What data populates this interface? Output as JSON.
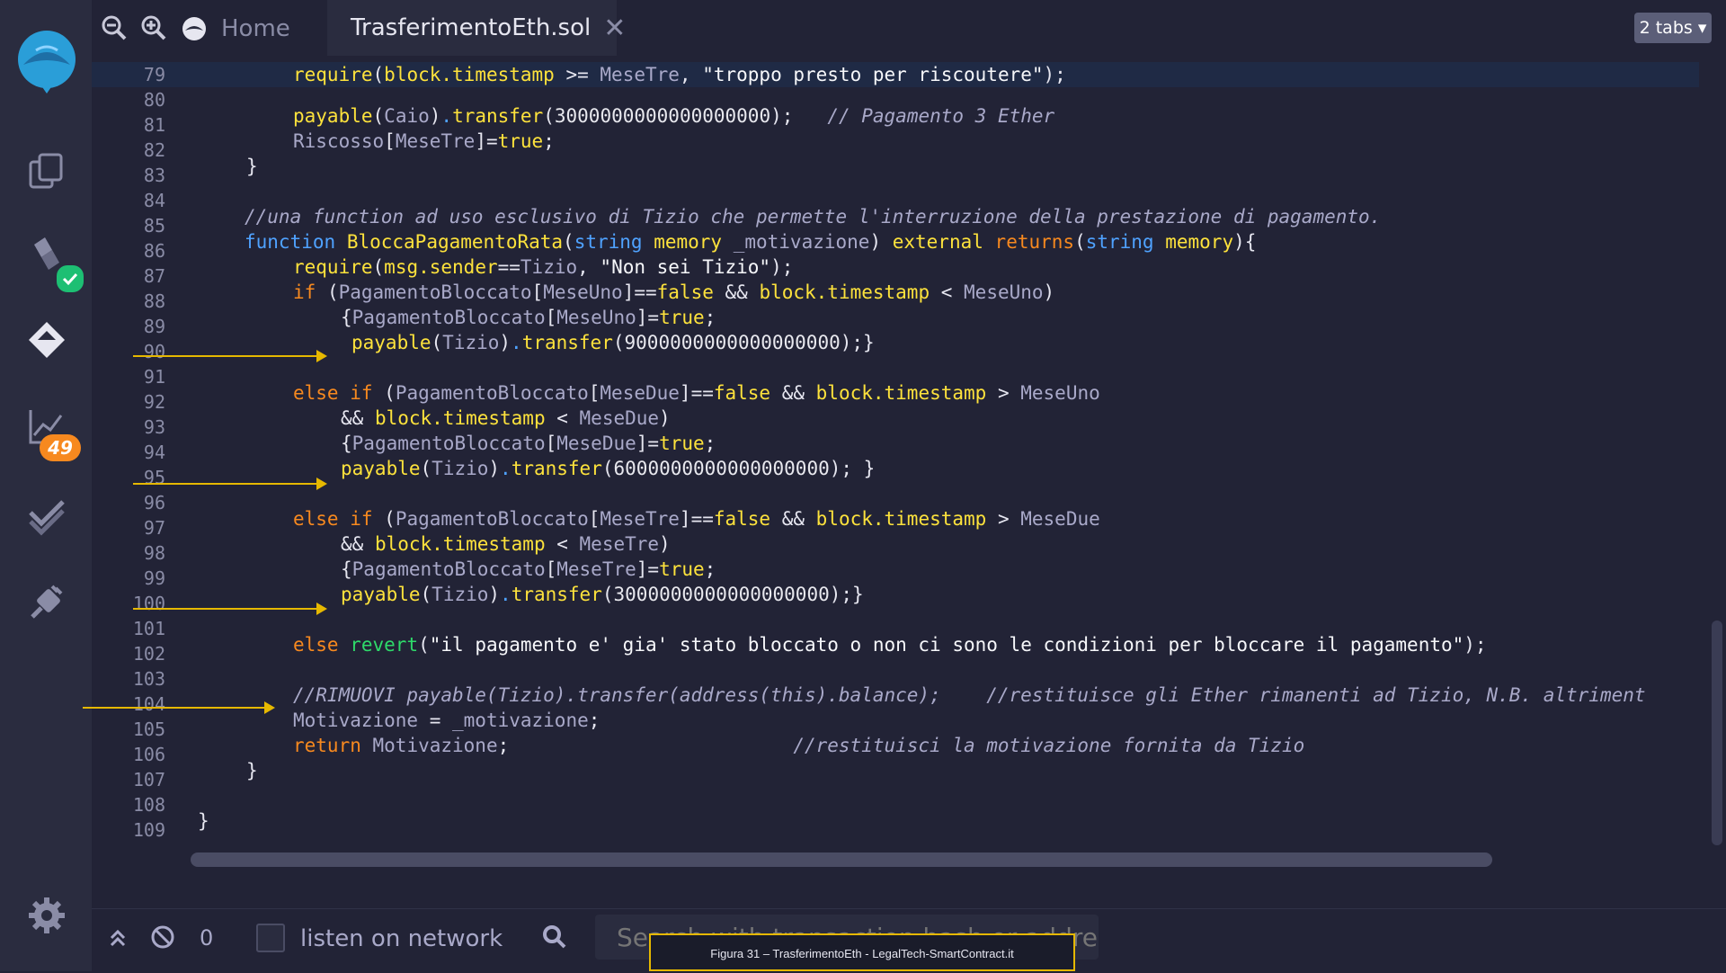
{
  "topbar": {
    "home_label": "Home",
    "file_tab": "TrasferimentoEth.sol",
    "close_glyph": "✕",
    "tabs_button": "2 tabs ▾"
  },
  "sidebar": {
    "badge_count": "49"
  },
  "editor": {
    "line_numbers": [
      "79",
      "80",
      "81",
      "82",
      "83",
      "84",
      "85",
      "86",
      "87",
      "88",
      "89",
      "90",
      "91",
      "92",
      "93",
      "94",
      "95",
      "96",
      "97",
      "98",
      "99",
      "100",
      "101",
      "102",
      "103",
      "104",
      "105",
      "106",
      "107",
      "108",
      "109"
    ]
  },
  "terminal": {
    "counter": "0",
    "listen_label": "listen on network",
    "search_placeholder": "Search with transaction hash or address"
  },
  "caption": "Figura 31 – TrasferimentoEth - LegalTech-SmartContract.it"
}
